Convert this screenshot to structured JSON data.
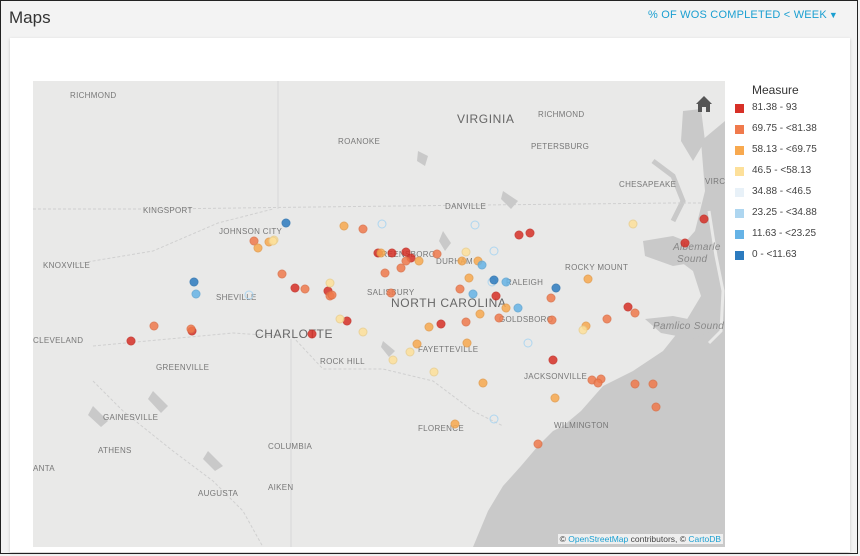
{
  "header": {
    "title": "Maps",
    "measure_selector": "% OF WOS COMPLETED < WEEK"
  },
  "map": {
    "city_labels": [
      {
        "name": "RICHMOND",
        "size": "sm"
      },
      {
        "name": "RICHMOND",
        "size": "sm"
      },
      {
        "name": "ROANOKE",
        "size": "sm"
      },
      {
        "name": "PETERSBURG",
        "size": "sm"
      },
      {
        "name": "CHESAPEAKE",
        "size": "sm"
      },
      {
        "name": "VIRC",
        "size": "sm"
      },
      {
        "name": "KINGSPORT",
        "size": "sm"
      },
      {
        "name": "JOHNSON CITY",
        "size": "sm"
      },
      {
        "name": "DANVILLE",
        "size": "sm"
      },
      {
        "name": "GREENSBORO",
        "size": "sm"
      },
      {
        "name": "DURHAM",
        "size": "sm"
      },
      {
        "name": "ROCKY MOUNT",
        "size": "sm"
      },
      {
        "name": "KNOXVILLE",
        "size": "sm"
      },
      {
        "name": "SHEVILLE",
        "size": "sm"
      },
      {
        "name": "SALISBURY",
        "size": "sm"
      },
      {
        "name": "RALEIGH",
        "size": "sm"
      },
      {
        "name": "GOLDSBORO",
        "size": "sm"
      },
      {
        "name": "CLEVELAND",
        "size": "sm"
      },
      {
        "name": "FAYETTEVILLE",
        "size": "sm"
      },
      {
        "name": "GREENVILLE",
        "size": "sm"
      },
      {
        "name": "ROCK HILL",
        "size": "sm"
      },
      {
        "name": "JACKSONVILLE",
        "size": "sm"
      },
      {
        "name": "GAINESVILLE",
        "size": "sm"
      },
      {
        "name": "FLORENCE",
        "size": "sm"
      },
      {
        "name": "WILMINGTON",
        "size": "sm"
      },
      {
        "name": "ATHENS",
        "size": "sm"
      },
      {
        "name": "COLUMBIA",
        "size": "sm"
      },
      {
        "name": "ANTA",
        "size": "sm"
      },
      {
        "name": "AUGUSTA",
        "size": "sm"
      },
      {
        "name": "AIKEN",
        "size": "sm"
      },
      {
        "name": "VIRGINIA",
        "size": "lg"
      },
      {
        "name": "NORTH CAROLINA",
        "size": "lg"
      },
      {
        "name": "CHARLOTTE",
        "size": "lg"
      },
      {
        "name": "Albemarle",
        "size": "md"
      },
      {
        "name": "Sound",
        "size": "md"
      },
      {
        "name": "Pamlico Sound",
        "size": "md"
      }
    ],
    "attribution": {
      "prefix": "©",
      "link1": "OpenStreetMap",
      "middle": "contributors, ©",
      "link2": "CartoDB"
    }
  },
  "legend": {
    "title": "Measure",
    "items": [
      {
        "label": "81.38 - 93",
        "color": "#d73027"
      },
      {
        "label": "69.75 - <81.38",
        "color": "#f07a4c"
      },
      {
        "label": "58.13 - <69.75",
        "color": "#f8a94f"
      },
      {
        "label": "46.5 - <58.13",
        "color": "#fde09a"
      },
      {
        "label": "34.88 - <46.5",
        "color": "#e8f1f8"
      },
      {
        "label": "23.25 - <34.88",
        "color": "#aed6f0"
      },
      {
        "label": "11.63 - <23.25",
        "color": "#66b3e6"
      },
      {
        "label": "0 - <11.63",
        "color": "#2c7bbf"
      }
    ]
  },
  "points": [
    {
      "c": 0
    },
    {
      "c": 0
    },
    {
      "c": 0
    },
    {
      "c": 0
    },
    {
      "c": 0
    },
    {
      "c": 0
    },
    {
      "c": 0
    },
    {
      "c": 0
    },
    {
      "c": 0
    },
    {
      "c": 0
    },
    {
      "c": 0
    },
    {
      "c": 0
    },
    {
      "c": 0
    },
    {
      "c": 0
    },
    {
      "c": 0
    },
    {
      "c": 0
    },
    {
      "c": 0
    },
    {
      "c": 0
    },
    {
      "c": 1
    },
    {
      "c": 1
    },
    {
      "c": 1
    },
    {
      "c": 1
    },
    {
      "c": 1
    },
    {
      "c": 1
    },
    {
      "c": 1
    },
    {
      "c": 1
    },
    {
      "c": 1
    },
    {
      "c": 1
    },
    {
      "c": 1
    },
    {
      "c": 1
    },
    {
      "c": 1
    },
    {
      "c": 1
    },
    {
      "c": 1
    },
    {
      "c": 1
    },
    {
      "c": 1
    },
    {
      "c": 1
    },
    {
      "c": 1
    },
    {
      "c": 1
    },
    {
      "c": 1
    },
    {
      "c": 1
    },
    {
      "c": 1
    },
    {
      "c": 1
    },
    {
      "c": 1
    },
    {
      "c": 1
    },
    {
      "c": 1
    },
    {
      "c": 2
    },
    {
      "c": 2
    },
    {
      "c": 2
    },
    {
      "c": 2
    },
    {
      "c": 2
    },
    {
      "c": 2
    },
    {
      "c": 2
    },
    {
      "c": 2
    },
    {
      "c": 2
    },
    {
      "c": 2
    },
    {
      "c": 2
    },
    {
      "c": 2
    },
    {
      "c": 2
    },
    {
      "c": 2
    },
    {
      "c": 2
    },
    {
      "c": 2
    },
    {
      "c": 2
    },
    {
      "c": 2
    },
    {
      "c": 3
    },
    {
      "c": 3
    },
    {
      "c": 3
    },
    {
      "c": 3
    },
    {
      "c": 3
    },
    {
      "c": 3
    },
    {
      "c": 3
    },
    {
      "c": 3
    },
    {
      "c": 3
    },
    {
      "c": 3
    },
    {
      "c": 3
    },
    {
      "c": 5
    },
    {
      "c": 5
    },
    {
      "c": 5
    },
    {
      "c": 5
    },
    {
      "c": 5
    },
    {
      "c": 5
    },
    {
      "c": 5
    },
    {
      "c": 6
    },
    {
      "c": 6
    },
    {
      "c": 6
    },
    {
      "c": 6
    },
    {
      "c": 6
    },
    {
      "c": 7
    },
    {
      "c": 7
    },
    {
      "c": 7
    },
    {
      "c": 7
    }
  ]
}
